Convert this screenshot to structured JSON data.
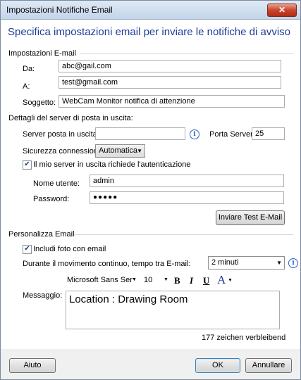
{
  "window": {
    "title": "Impostazioni Notifiche Email",
    "close_glyph": "✕"
  },
  "header": "Specifica impostazioni email per inviare le notifiche di avviso",
  "email_settings": {
    "group_label": "Impostazioni E-mail",
    "from_label": "Da:",
    "from_value": "abc@gail.com",
    "to_label": "A:",
    "to_value": "test@gmail.com",
    "subject_label": "Soggetto:",
    "subject_value": "WebCam Monitor notifica di attenzione"
  },
  "server": {
    "group_label": "Dettagli del server di posta in uscita:",
    "server_label": "Server posta in uscita:",
    "server_value": "",
    "info_glyph": "i",
    "port_label": "Porta Server:",
    "port_value": "25",
    "security_label": "Sicurezza connessione:",
    "security_value": "Automatica",
    "auth_label": "Il mio server in uscita richiede l'autenticazione",
    "auth_checked": true,
    "username_label": "Nome utente:",
    "username_value": "admin",
    "password_label": "Password:",
    "password_value": "●●●●●",
    "test_button": "Inviare Test E-Mail"
  },
  "personalize": {
    "group_label": "Personalizza Email",
    "photo_label": "Includi foto con email",
    "photo_checked": true,
    "interval_label": "Durante il movimento continuo, tempo tra E-mail:",
    "interval_value": "2 minuti",
    "message_label": "Messaggio:",
    "font_name": "Microsoft Sans Ser",
    "font_size": "10",
    "bold": "B",
    "italic": "I",
    "underline": "U",
    "font_color": "A",
    "message_value": "Location : Drawing Room",
    "remaining": "177 zeichen verbleibend"
  },
  "footer": {
    "help_button": "Aiuto",
    "ok_button": "OK",
    "cancel_button": "Annullare"
  },
  "check_glyph": "✔",
  "dropdown_glyph": "▼"
}
